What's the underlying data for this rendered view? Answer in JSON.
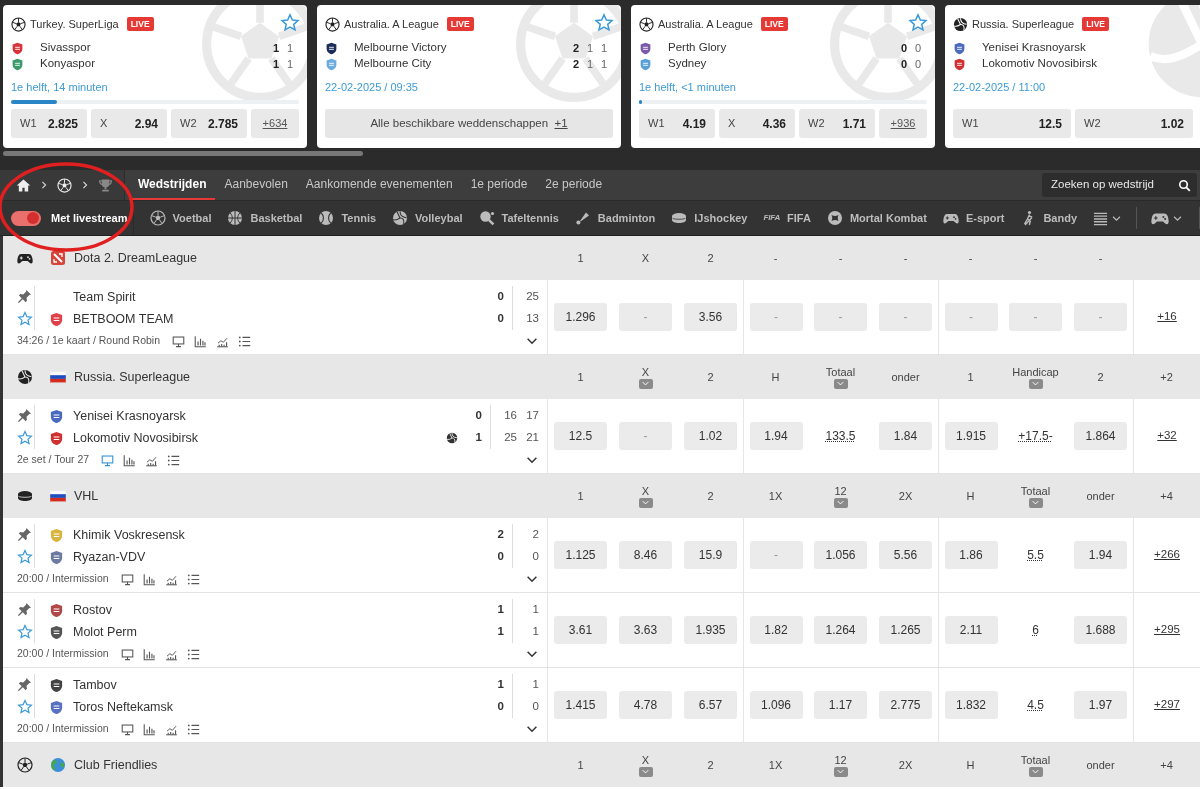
{
  "top_cards": [
    {
      "kind": "soccer",
      "league": "Turkey. SuperLiga",
      "badge": "LIVE",
      "favorite": false,
      "teams": [
        {
          "name": "Sivasspor",
          "color": "#d8333a",
          "scores": [
            "1",
            "1"
          ]
        },
        {
          "name": "Konyaspor",
          "color": "#3a9a6a",
          "scores": [
            "1",
            "1"
          ]
        }
      ],
      "status": "1e helft, 14 minuten",
      "level": 0.16,
      "odds": [
        {
          "label": "W1",
          "value": "2.825"
        },
        {
          "label": "X",
          "value": "2.94"
        },
        {
          "label": "W2",
          "value": "2.785"
        }
      ],
      "more": "+634"
    },
    {
      "kind": "soccer",
      "league": "Australia. A League",
      "badge": "LIVE",
      "favorite": false,
      "teams": [
        {
          "name": "Melbourne Victory",
          "color": "#1d2b5a",
          "scores": [
            "2",
            "1",
            "1"
          ]
        },
        {
          "name": "Melbourne City",
          "color": "#6cabdd",
          "scores": [
            "2",
            "1",
            "1"
          ]
        }
      ],
      "status": "22-02-2025 / 09:35",
      "all_bets": {
        "label": "Alle beschikbare weddenschappen",
        "more": "+1"
      }
    },
    {
      "kind": "soccer",
      "league": "Australia. A League",
      "badge": "LIVE",
      "favorite": false,
      "teams": [
        {
          "name": "Perth Glory",
          "color": "#7a5aa8",
          "scores": [
            "0",
            "0"
          ]
        },
        {
          "name": "Sydney",
          "color": "#5aa0d8",
          "scores": [
            "0",
            "0"
          ]
        }
      ],
      "status": "1e helft, <1 minuten",
      "level": 0.01,
      "odds": [
        {
          "label": "W1",
          "value": "4.19"
        },
        {
          "label": "X",
          "value": "4.36"
        },
        {
          "label": "W2",
          "value": "1.71"
        }
      ],
      "more": "+936"
    },
    {
      "kind": "volleyball",
      "league": "Russia. Superleague",
      "badge": "LIVE",
      "teams": [
        {
          "name": "Yenisei Krasnoyarsk",
          "color": "#4a6ac0"
        },
        {
          "name": "Lokomotiv Novosibirsk",
          "color": "#d03030"
        }
      ],
      "status": "22-02-2025 / 11:00",
      "odds": [
        {
          "label": "W1",
          "value": "12.5"
        },
        {
          "label": "W2",
          "value": "1.02"
        }
      ]
    }
  ],
  "breadcrumb": [
    {
      "kind": "home"
    },
    {
      "kind": "soccer"
    },
    {
      "kind": "trophy"
    }
  ],
  "tabs": [
    {
      "label": "Wedstrijden",
      "selected": true
    },
    {
      "label": "Aanbevolen",
      "selected": false
    },
    {
      "label": "Aankomende evenementen",
      "selected": false
    },
    {
      "label": "1e periode",
      "selected": false
    },
    {
      "label": "2e periode",
      "selected": false
    }
  ],
  "search": {
    "placeholder": "Zoeken op wedstrijd"
  },
  "livestream_toggle": {
    "label": "Met livestream",
    "on": true
  },
  "sports": [
    {
      "kind": "soccer",
      "label": "Voetbal"
    },
    {
      "kind": "basketball",
      "label": "Basketbal"
    },
    {
      "kind": "tennis",
      "label": "Tennis"
    },
    {
      "kind": "volleyball",
      "label": "Volleybal"
    },
    {
      "kind": "tabletennis",
      "label": "Tafeltennis"
    },
    {
      "kind": "badminton",
      "label": "Badminton"
    },
    {
      "kind": "hockey",
      "label": "IJshockey"
    },
    {
      "kind": "fifa",
      "logo_text": "FIFA",
      "label": "FIFA"
    },
    {
      "kind": "mortal",
      "label": "Mortal Kombat"
    },
    {
      "kind": "esport",
      "label": "E-sport"
    },
    {
      "kind": "bandy",
      "label": "Bandy"
    }
  ],
  "leagues": [
    {
      "kind": "esport",
      "flag": {
        "kind": "dota"
      },
      "name": "Dota 2. DreamLeague",
      "headers": [
        {
          "label": "1",
          "dropdown": false
        },
        {
          "label": "X",
          "dropdown": false
        },
        {
          "label": "2",
          "dropdown": false
        },
        {
          "label": "-",
          "dropdown": false
        },
        {
          "label": "-",
          "dropdown": false
        },
        {
          "label": "-",
          "dropdown": false
        },
        {
          "label": "-",
          "dropdown": false
        },
        {
          "label": "-",
          "dropdown": false
        },
        {
          "label": "-",
          "dropdown": false
        }
      ],
      "matches": [
        {
          "teams": [
            {
              "name": "Team Spirit",
              "serving": false,
              "score": "0",
              "periods": [
                "25"
              ]
            },
            {
              "name": "BETBOOM TEAM",
              "color": "#e0404a",
              "serving": false,
              "score": "0",
              "periods": [
                "13"
              ]
            }
          ],
          "info": "34:26 / 1e kaart / Round Robin",
          "stream_active": false,
          "odds": [
            {
              "kind": "price",
              "value": "1.296"
            },
            {
              "kind": "none",
              "value": "-"
            },
            {
              "kind": "price",
              "value": "3.56"
            },
            {
              "kind": "none",
              "value": "-"
            },
            {
              "kind": "none",
              "value": "-"
            },
            {
              "kind": "none",
              "value": "-"
            },
            {
              "kind": "none",
              "value": "-"
            },
            {
              "kind": "none",
              "value": "-"
            },
            {
              "kind": "none",
              "value": "-"
            }
          ],
          "more": "+16"
        }
      ]
    },
    {
      "kind": "volleyball",
      "flag": {
        "kind": "ru"
      },
      "name": "Russia. Superleague",
      "headers": [
        {
          "label": "1",
          "dropdown": false
        },
        {
          "label": "X",
          "dropdown": true
        },
        {
          "label": "2",
          "dropdown": false
        },
        {
          "label": "H",
          "dropdown": false
        },
        {
          "label": "Totaal",
          "dropdown": true
        },
        {
          "label": "onder",
          "dropdown": false
        },
        {
          "label": "1",
          "dropdown": false
        },
        {
          "label": "Handicap",
          "dropdown": true
        },
        {
          "label": "2",
          "dropdown": false
        }
      ],
      "more": "+2",
      "matches": [
        {
          "teams": [
            {
              "name": "Yenisei Krasnoyarsk",
              "color": "#4a6ac0",
              "serving": false,
              "score": "0",
              "periods": [
                "16",
                "17"
              ]
            },
            {
              "name": "Lokomotiv Novosibirsk",
              "color": "#d03030",
              "serving": true,
              "score": "1",
              "periods": [
                "25",
                "21"
              ]
            }
          ],
          "info": "2e set / Tour 27",
          "stream_active": true,
          "odds": [
            {
              "kind": "price",
              "value": "12.5"
            },
            {
              "kind": "none",
              "value": "-"
            },
            {
              "kind": "price",
              "value": "1.02"
            },
            {
              "kind": "price",
              "value": "1.94"
            },
            {
              "kind": "param",
              "value": "133.5"
            },
            {
              "kind": "price",
              "value": "1.84"
            },
            {
              "kind": "price",
              "value": "1.915"
            },
            {
              "kind": "param",
              "value": "+17.5-"
            },
            {
              "kind": "price",
              "value": "1.864"
            }
          ],
          "more": "+32"
        }
      ]
    },
    {
      "kind": "hockey",
      "flag": {
        "kind": "ru"
      },
      "name": "VHL",
      "headers": [
        {
          "label": "1",
          "dropdown": false
        },
        {
          "label": "X",
          "dropdown": true
        },
        {
          "label": "2",
          "dropdown": false
        },
        {
          "label": "1X",
          "dropdown": false
        },
        {
          "label": "12",
          "dropdown": true
        },
        {
          "label": "2X",
          "dropdown": false
        },
        {
          "label": "H",
          "dropdown": false
        },
        {
          "label": "Totaal",
          "dropdown": true
        },
        {
          "label": "onder",
          "dropdown": false
        }
      ],
      "more": "+4",
      "matches": [
        {
          "teams": [
            {
              "name": "Khimik Voskresensk",
              "color": "#d8b440",
              "serving": false,
              "score": "2",
              "periods": [
                "2"
              ]
            },
            {
              "name": "Ryazan-VDV",
              "color": "#6a7aa0",
              "serving": false,
              "score": "0",
              "periods": [
                "0"
              ]
            }
          ],
          "info": "20:00 / Intermission",
          "stream_active": false,
          "odds": [
            {
              "kind": "price",
              "value": "1.125"
            },
            {
              "kind": "price",
              "value": "8.46"
            },
            {
              "kind": "price",
              "value": "15.9"
            },
            {
              "kind": "none",
              "value": "-"
            },
            {
              "kind": "price",
              "value": "1.056"
            },
            {
              "kind": "price",
              "value": "5.56"
            },
            {
              "kind": "price",
              "value": "1.86"
            },
            {
              "kind": "param",
              "value": "5.5"
            },
            {
              "kind": "price",
              "value": "1.94"
            }
          ],
          "more": "+266"
        },
        {
          "teams": [
            {
              "name": "Rostov",
              "color": "#b04848",
              "serving": false,
              "score": "1",
              "periods": [
                "1"
              ]
            },
            {
              "name": "Molot Perm",
              "color": "#555555",
              "serving": false,
              "score": "1",
              "periods": [
                "1"
              ]
            }
          ],
          "info": "20:00 / Intermission",
          "stream_active": false,
          "odds": [
            {
              "kind": "price",
              "value": "3.61"
            },
            {
              "kind": "price",
              "value": "3.63"
            },
            {
              "kind": "price",
              "value": "1.935"
            },
            {
              "kind": "price",
              "value": "1.82"
            },
            {
              "kind": "price",
              "value": "1.264"
            },
            {
              "kind": "price",
              "value": "1.265"
            },
            {
              "kind": "price",
              "value": "2.11"
            },
            {
              "kind": "param",
              "value": "6"
            },
            {
              "kind": "price",
              "value": "1.688"
            }
          ],
          "more": "+295"
        },
        {
          "teams": [
            {
              "name": "Tambov",
              "color": "#444444",
              "serving": false,
              "score": "1",
              "periods": [
                "1"
              ]
            },
            {
              "name": "Toros Neftekamsk",
              "color": "#5a70c0",
              "serving": false,
              "score": "0",
              "periods": [
                "0"
              ]
            }
          ],
          "info": "20:00 / Intermission",
          "stream_active": false,
          "odds": [
            {
              "kind": "price",
              "value": "1.415"
            },
            {
              "kind": "price",
              "value": "4.78"
            },
            {
              "kind": "price",
              "value": "6.57"
            },
            {
              "kind": "price",
              "value": "1.096"
            },
            {
              "kind": "price",
              "value": "1.17"
            },
            {
              "kind": "price",
              "value": "2.775"
            },
            {
              "kind": "price",
              "value": "1.832"
            },
            {
              "kind": "param",
              "value": "4.5"
            },
            {
              "kind": "price",
              "value": "1.97"
            }
          ],
          "more": "+297"
        }
      ]
    },
    {
      "kind": "soccer",
      "flag": {
        "kind": "world"
      },
      "name": "Club Friendlies",
      "headers": [
        {
          "label": "1",
          "dropdown": false
        },
        {
          "label": "X",
          "dropdown": true
        },
        {
          "label": "2",
          "dropdown": false
        },
        {
          "label": "1X",
          "dropdown": false
        },
        {
          "label": "12",
          "dropdown": true
        },
        {
          "label": "2X",
          "dropdown": false
        },
        {
          "label": "H",
          "dropdown": false
        },
        {
          "label": "Totaal",
          "dropdown": true
        },
        {
          "label": "onder",
          "dropdown": false
        }
      ],
      "more": "+4"
    }
  ],
  "annotation": {
    "kind": "circle",
    "color": "#e02020"
  }
}
